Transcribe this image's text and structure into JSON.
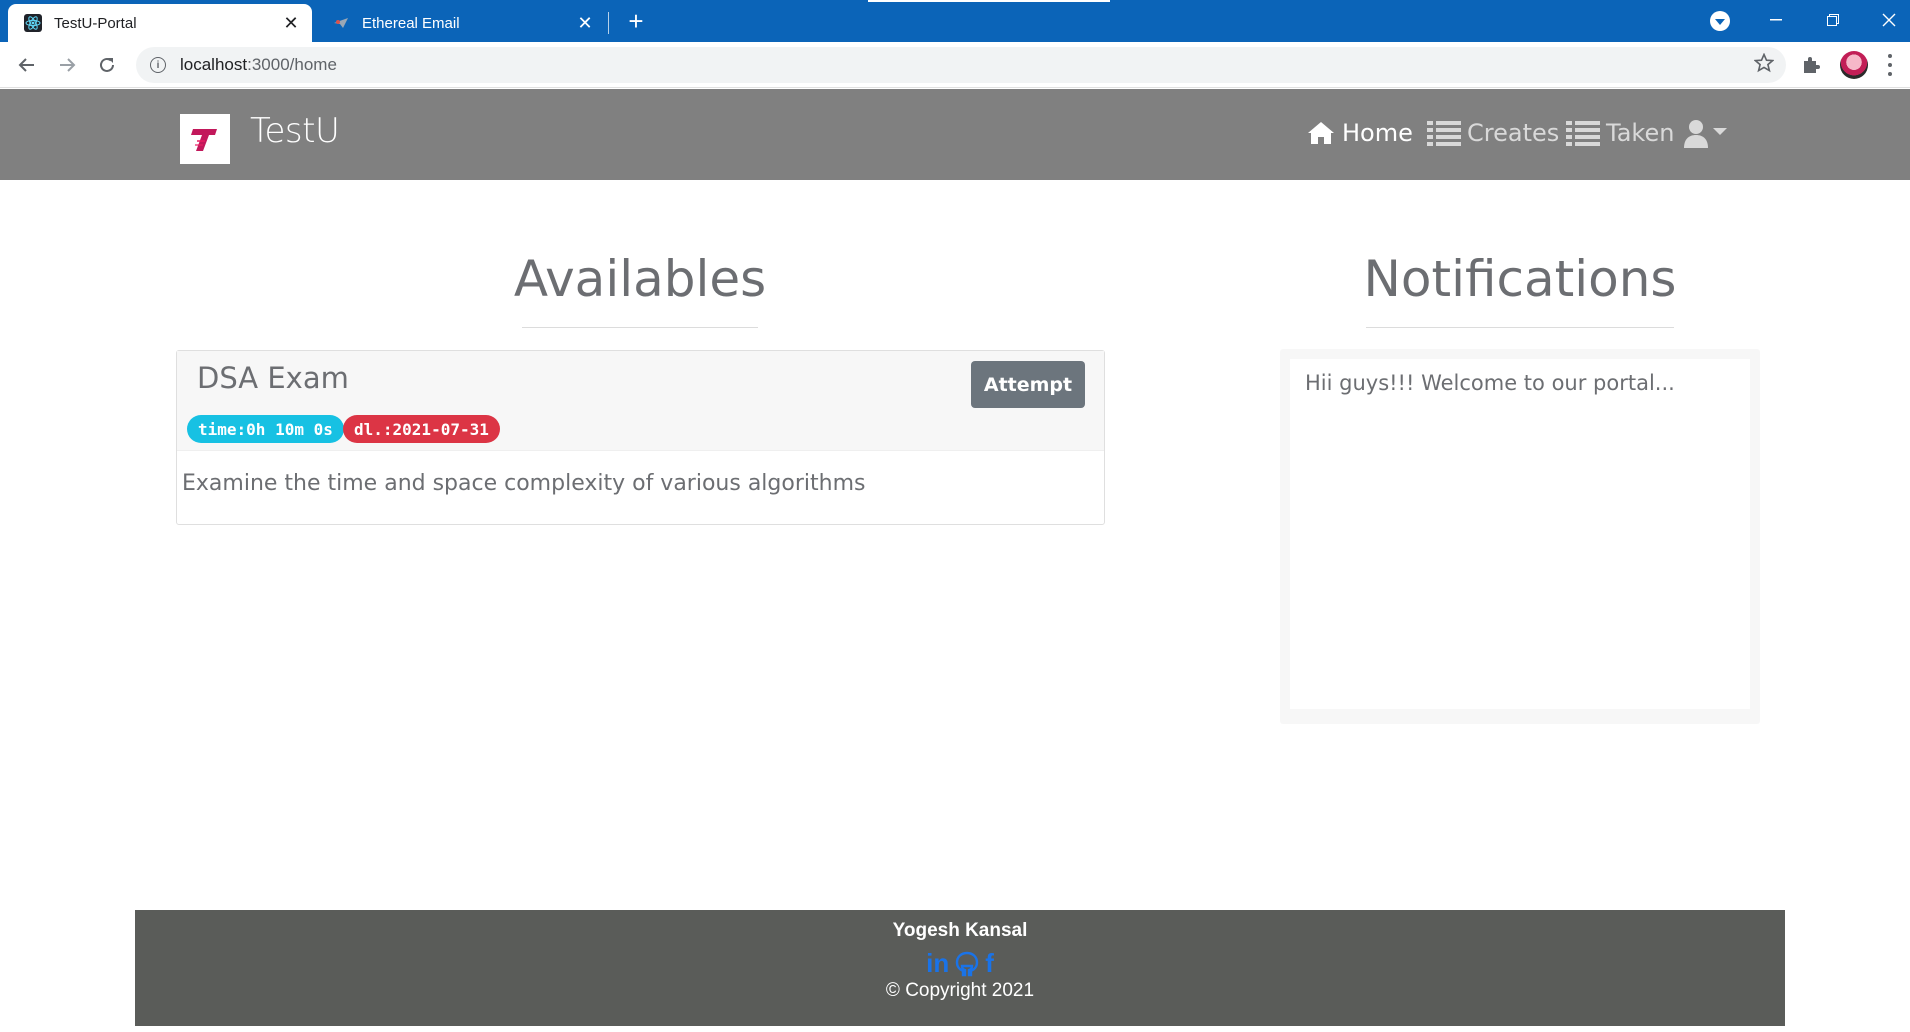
{
  "browser": {
    "tabs": [
      {
        "title": "TestU-Portal",
        "active": true,
        "icon": "react-icon"
      },
      {
        "title": "Ethereal Email",
        "active": false,
        "icon": "ethereal-icon"
      }
    ],
    "close_glyph": "✕",
    "new_tab_glyph": "+",
    "url_host": "localhost",
    "url_path": ":3000/home"
  },
  "navbar": {
    "brand_letter": "T",
    "brand_name": "TestU",
    "links": {
      "home": "Home",
      "creates": "Creates",
      "taken": "Taken"
    },
    "colors": {
      "background": "#808080",
      "brand_red": "#c2185b"
    }
  },
  "availables": {
    "title": "Availables",
    "exams": [
      {
        "name": "DSA Exam",
        "attempt_label": "Attempt",
        "time_badge": "time:0h 10m 0s",
        "deadline_badge": "dl.:2021-07-31",
        "description": "Examine the time and space complexity of various algorithms"
      }
    ]
  },
  "notifications": {
    "title": "Notifications",
    "message": "Hii guys!!! Welcome to our portal..."
  },
  "footer": {
    "author": "Yogesh Kansal",
    "social": {
      "linkedin": "in",
      "github": "github-icon",
      "facebook": "f"
    },
    "copyright": "© Copyright 2021"
  }
}
